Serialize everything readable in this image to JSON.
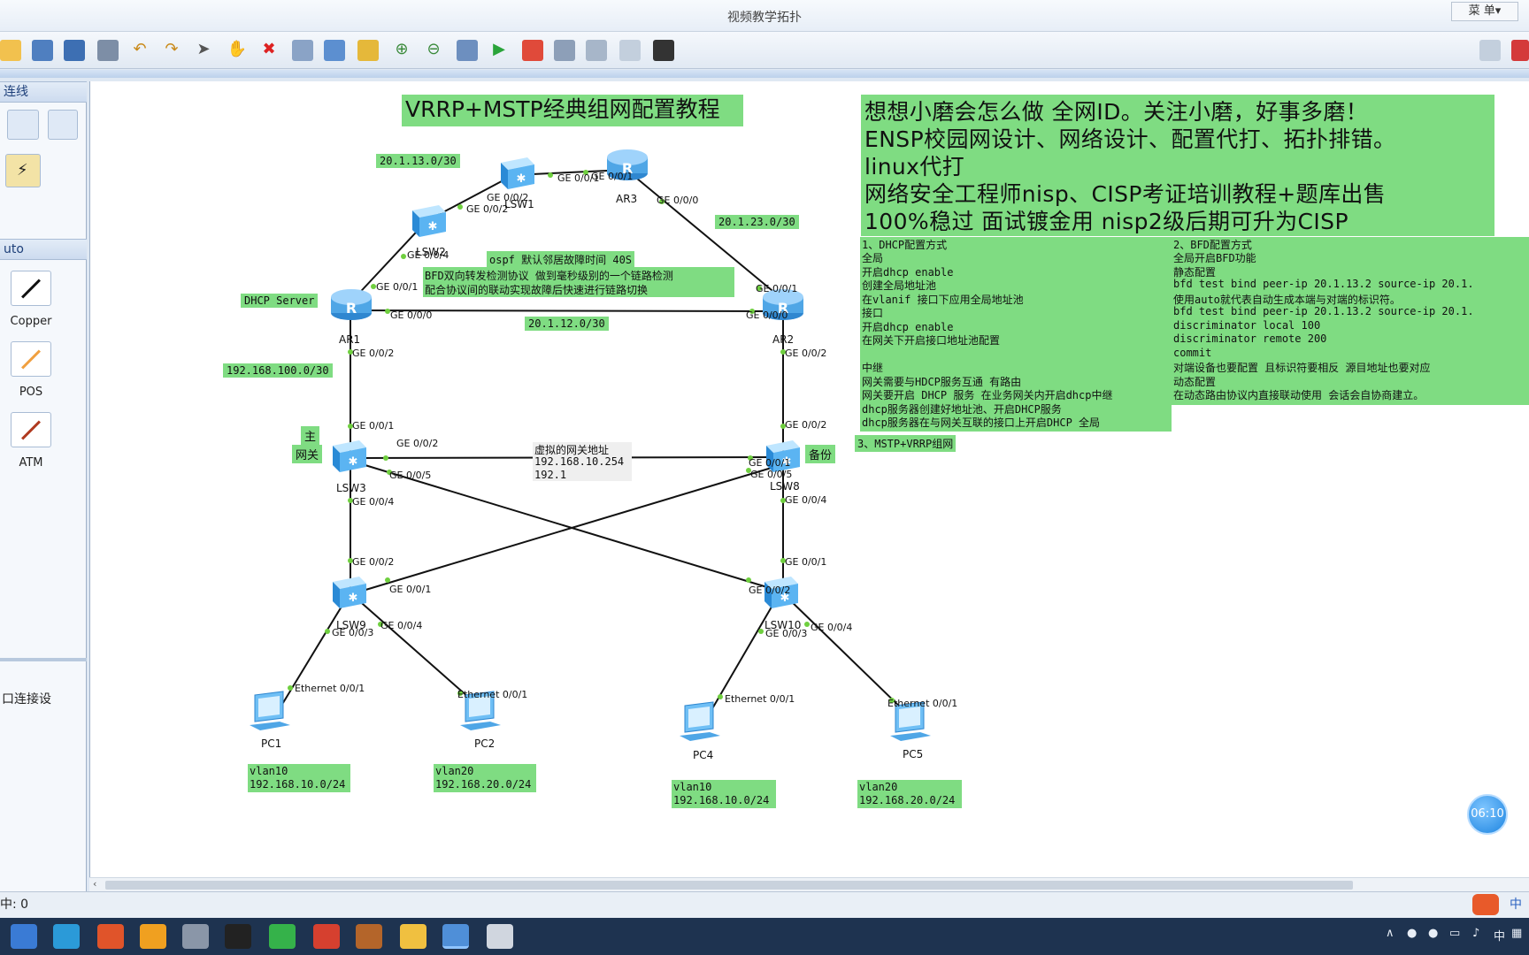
{
  "window": {
    "title": "视频教学拓扑",
    "menu_label": "菜 单▾"
  },
  "left_panel": {
    "section1_header": "连线",
    "section2_header": "uto",
    "items": [
      {
        "label": "Copper",
        "icon": "copper-cable-icon"
      },
      {
        "label": "POS",
        "icon": "pos-cable-icon"
      },
      {
        "label": "ATM",
        "icon": "atm-cable-icon"
      }
    ],
    "bottom_text": "口连接设"
  },
  "status": {
    "text": "中: 0"
  },
  "topology": {
    "title": "VRRP+MSTP经典组网配置教程",
    "promo_lines": [
      "想想小磨会怎么做 全网ID。关注小磨，好事多磨！",
      "ENSP校园网设计、网络设计、配置代打、拓扑排错。",
      "linux代打",
      "网络安全工程师nisp、CISP考证培训教程+题库出售",
      "100%稳过 面试镀金用 nisp2级后期可升为CISP"
    ],
    "devices": {
      "ar1": "AR1",
      "ar2": "AR2",
      "ar3": "AR3",
      "lsw1": "LSW1",
      "lsw2": "LSW2",
      "lsw3": "LSW3",
      "lsw8": "LSW8",
      "lsw9": "LSW9",
      "lsw10": "LSW10",
      "pc1": "PC1",
      "pc2": "PC2",
      "pc4": "PC4",
      "pc5": "PC5"
    },
    "ports": {
      "lsw1_g2": "GE 0/0/2",
      "lsw1_g1": "GE 0/0/1",
      "ar3_g1": "GE 0/0/1",
      "ar3_g0": "GE 0/0/0",
      "lsw2_g2": "GE 0/0/2",
      "lsw2_g4": "GE 0/0/4",
      "ar1_g1": "GE 0/0/1",
      "ar1_g0": "GE 0/0/0",
      "ar1_g2": "GE 0/0/2",
      "ar2_g1": "GE 0/0/1",
      "ar2_g0": "GE 0/0/0",
      "ar2_g2": "GE 0/0/2",
      "lsw3_g1": "GE 0/0/1",
      "lsw3_g2": "GE 0/0/2",
      "lsw3_g5": "GE 0/0/5",
      "lsw3_g4": "GE 0/0/4",
      "lsw8_g2": "GE 0/0/2",
      "lsw8_g1": "GE 0/0/1",
      "lsw8_g5": "GE 0/0/5",
      "lsw8_g4": "GE 0/0/4",
      "lsw9_g2": "GE 0/0/2",
      "lsw9_g1": "GE 0/0/1",
      "lsw9_g4": "GE 0/0/4",
      "lsw9_g3": "GE 0/0/3",
      "lsw10_g1": "GE 0/0/1",
      "lsw10_g2": "GE 0/0/2",
      "lsw10_g3": "GE 0/0/3",
      "lsw10_g4": "GE 0/0/4",
      "pc1_e": "Ethernet 0/0/1",
      "pc2_e": "Ethernet 0/0/1",
      "pc4_e": "Ethernet 0/0/1",
      "pc5_e": "Ethernet 0/0/1"
    },
    "tags": {
      "net13": "20.1.13.0/30",
      "net23": "20.1.23.0/30",
      "net12": "20.1.12.0/30",
      "net100": "192.168.100.0/30",
      "dhcp_server": "DHCP Server",
      "ospf": "ospf 默认邻居故障时间 40S",
      "bfd_line1": "BFD双向转发检测协议 做到毫秒级别的一个链路检测",
      "bfd_line2": "配合协议间的联动实现故障后快速进行链路切换",
      "master": "主",
      "gateway": "网关",
      "backup": "备份",
      "mstp_vrrp": "3、MSTP+VRRP组网",
      "pc1_vlan": "vlan10",
      "pc1_net": "192.168.10.0/24",
      "pc2_vlan": "vlan20",
      "pc2_net": "192.168.20.0/24",
      "pc4_vlan": "vlan10",
      "pc4_net": "192.168.10.0/24",
      "pc5_vlan": "vlan20",
      "pc5_net": "192.168.20.0/24"
    },
    "vip_lines": [
      "虚拟的网关地址",
      "192.168.10.254",
      "192.1"
    ],
    "dhcp_note": [
      "1、DHCP配置方式",
      "全局",
      "  开启dhcp enable",
      "  创建全局地址池",
      "  在vlanif 接口下应用全局地址池",
      "接口",
      "  开启dhcp enable",
      "  在网关下开启接口地址池配置",
      "",
      "中继",
      "  网关需要与HDCP服务互通 有路由",
      "  网关要开启 DHCP 服务 在业务网关内开启dhcp中继",
      "  dhcp服务器创建好地址池、开启DHCP服务",
      "  dhcp服务器在与网关互联的接口上开启DHCP 全局"
    ],
    "bfd_note": [
      "2、BFD配置方式",
      "全局开启BFD功能",
      " 静态配置",
      "  bfd  test bind  peer-ip  20.1.13.2 source-ip  20.1.",
      "  使用auto就代表自动生成本端与对端的标识符。",
      "  bfd  test bind  peer-ip  20.1.13.2 source-ip  20.1.",
      "  discriminator local 100",
      "  discriminator remote 200",
      "  commit",
      "  对端设备也要配置 且标识符要相反  源目地址也要对应",
      " 动态配置",
      "  在动态路由协议内直接联动使用 会话会自协商建立。"
    ]
  },
  "timer": "06:10",
  "tray": {
    "ime": "中"
  }
}
